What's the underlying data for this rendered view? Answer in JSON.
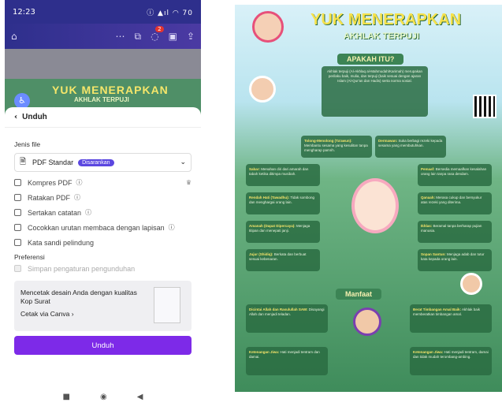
{
  "status_bar": {
    "time": "12:23",
    "icons": "ⓘ  ▲ıl ◠ 70"
  },
  "toolbar": {
    "notif_count": "2"
  },
  "canvas_preview": {
    "title": "YUK MENERAPKAN",
    "subtitle": "AKHLAK TERPUJI"
  },
  "sheet": {
    "title": "Unduh",
    "file_type_label": "Jenis file",
    "file_type_value": "PDF Standar",
    "recommended_badge": "Disarankan",
    "options": [
      {
        "label": "Kompres PDF",
        "info": true,
        "crown": true
      },
      {
        "label": "Ratakan PDF",
        "info": true
      },
      {
        "label": "Sertakan catatan",
        "info": true
      },
      {
        "label": "Cocokkan urutan membaca dengan lapisan",
        "info": true
      },
      {
        "label": "Kata sandi pelindung",
        "info": false
      }
    ],
    "preferences_label": "Preferensi",
    "save_settings": "Simpan pengaturan pengunduhan",
    "promo_text": "Mencetak desain Anda dengan kualitas Kop Surat",
    "promo_link": "Cetak via Canva",
    "download_button": "Unduh"
  },
  "poster": {
    "title": "YUK MENERAPKAN",
    "subtitle": "AKHLAK TERPUJI",
    "section_what": "APAKAH ITU?",
    "what_text": "Akhlak terpuji (Al-Akhlaq al-Mahmudah/Karimah) merupakan perilaku baik, mulia, dan terpuji (baik sesuai dengan ajaran Islam (Al-Qur'an dan Hadis) serta norma sosial.",
    "section_benefit": "Manfaat",
    "items": [
      {
        "t": "Tolong-Menolong (Ta'awun):",
        "d": "Membantu sesama yang kesulitan tanpa mengharap pamrih."
      },
      {
        "t": "Dermawan:",
        "d": "Suka berbagi rezeki kepada sesama yang membutuhkan."
      },
      {
        "t": "Sabar:",
        "d": "Menahan diri dari amarah dan tabah ketika ditimpa musibah."
      },
      {
        "t": "Pemaaf:",
        "d": "Bersedia memaafkan kesalahan orang lain tanpa rasa dendam."
      },
      {
        "t": "Rendah Hati (Tawadhu):",
        "d": "Tidak sombong dan menghargai orang lain."
      },
      {
        "t": "Qanaah:",
        "d": "Merasa cukup dan bersyukur atas rezeki yang diterima."
      },
      {
        "t": "Amanah (Dapat Dipercaya):",
        "d": "Menjaga titipan dan menepati janji."
      },
      {
        "t": "Ikhlas:",
        "d": "Beramal tanpa berharap pujian manusia."
      },
      {
        "t": "Jujur (Shidiq):",
        "d": "Berkata dan berbuat sesuai kebenaran."
      },
      {
        "t": "Sopan Santun:",
        "d": "Menjaga adab dan tutur kata kepada orang lain."
      },
      {
        "t": "Dicintai Allah dan Rasulullah SAW:",
        "d": "Disayangi Allah dan menjadi teladan."
      },
      {
        "t": "Berat Timbangan Amal Baik:",
        "d": "Akhlak baik memberatkan timbangan amal."
      },
      {
        "t": "Ketenangan Jiwa:",
        "d": "Hati menjadi tentram dan damai."
      },
      {
        "t": "Ketenangan Jiwa:",
        "d": "Hati menjadi tentram, damai dan tidak mudah terombang-ambing."
      }
    ]
  }
}
